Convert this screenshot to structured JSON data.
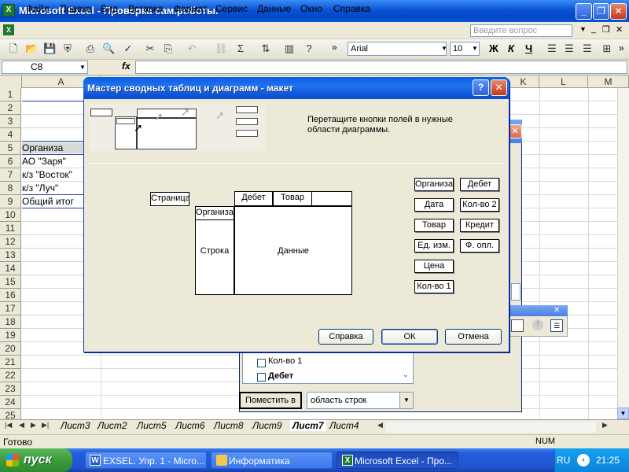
{
  "window": {
    "title": "Microsoft Excel - Проверка сам.роботы.",
    "app_icon": "excel-icon",
    "caption_buttons": [
      "minimize-icon",
      "restore-icon",
      "close-icon"
    ]
  },
  "menu": {
    "items": [
      "Файл",
      "Правка",
      "Вид",
      "Вставка",
      "Формат",
      "Сервис",
      "Данные",
      "Окно",
      "Справка"
    ],
    "ask_placeholder": "Введите вопрос"
  },
  "toolbar": {
    "font_name": "Arial",
    "font_size": "10",
    "bold": "Ж",
    "italic": "К",
    "underline": "Ч",
    "sum": "Σ"
  },
  "formula_bar": {
    "name_box": "C8",
    "fx": "fx",
    "value": ""
  },
  "grid": {
    "columns_visible": [
      "A",
      "K",
      "L",
      "M"
    ],
    "rows": [
      "1",
      "2",
      "3",
      "4",
      "5",
      "6",
      "7",
      "8",
      "9",
      "10",
      "11",
      "12",
      "13",
      "14",
      "15",
      "16",
      "17",
      "18",
      "19",
      "20",
      "21",
      "22",
      "23",
      "24",
      "25"
    ],
    "cells": {
      "a5": "Организа",
      "a6": "АО \"Заря\"",
      "a7": "к/з \"Восток\"",
      "a8": "к/з \"Луч\"",
      "a9": "Общий итог"
    }
  },
  "sheet_tabs": {
    "tabs": [
      "Лист3",
      "Лист2",
      "Лист5",
      "Лист6",
      "Лист8",
      "Лист9",
      "Лист7",
      "Лист4"
    ],
    "active": "Лист7"
  },
  "status": {
    "left": "Готово",
    "right": "NUM"
  },
  "taskbar": {
    "start_label": "пуск",
    "buttons": [
      {
        "label": "EXSEL. Упр. 1 - Micro...",
        "icon": "word-icon",
        "active": false
      },
      {
        "label": "Информатика",
        "icon": "folder-icon",
        "active": false
      },
      {
        "label": "Microsoft Excel - Про...",
        "icon": "excel-icon",
        "active": true
      }
    ],
    "lang": "RU",
    "clock": "21:25"
  },
  "wizard": {
    "title": "Мастер сводных таблиц и диаграмм - макет",
    "instruction": "Перетащите кнопки полей в нужные области диаграммы.",
    "areas": {
      "page": "Страница",
      "row_header": "Организа",
      "row": "Строка",
      "column_fields": [
        "Дебет",
        "Товар"
      ],
      "data": "Данные"
    },
    "fields_left": [
      "Организа",
      "Дата",
      "Товар",
      "Ед. изм.",
      "Цена",
      "Кол-во 1"
    ],
    "fields_right": [
      "Дебет",
      "Кол-во 2",
      "Кредит",
      "Ф. опл."
    ],
    "buttons": {
      "help": "Справка",
      "ok": "ОК",
      "cancel": "Отмена"
    }
  },
  "field_list": {
    "items": [
      "Кол-во 1",
      "Дебет"
    ],
    "place_button": "Поместить в",
    "place_target": "область строк"
  }
}
